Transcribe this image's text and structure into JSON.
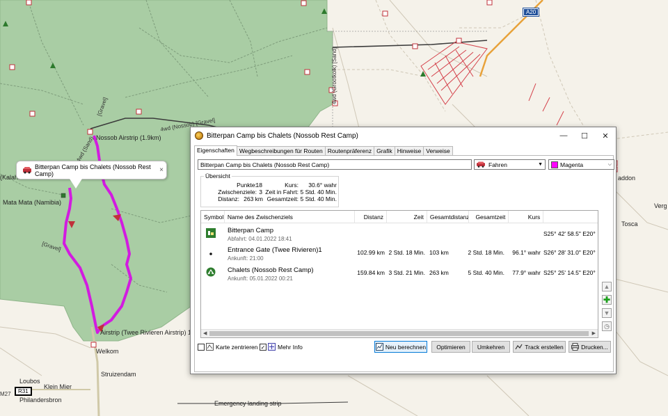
{
  "map": {
    "labels": {
      "nossob_airstrip": "Nossob Airstrip (1.9km)",
      "kalahari": "(Kalahari",
      "mata_mata": "Mata Mata (Namibia)",
      "gravel1": "[Gravel]",
      "gravel2": "[Gravel]",
      "nossob_road": "4wd (Nossob) [Gravel]",
      "grootkolk_road": "4wd (Grootkolk) [Sand]",
      "fourwd_sand": "4wd (Sand)",
      "twee_rivieren": "Airstrip (Twee Rivieren Airstrip) 1",
      "welkom": "Welkom",
      "struizendam": "Struizendam",
      "loubos": "Loubos",
      "klein_mier": "Klein Mier",
      "philandersbron": "Philandersbron",
      "emergency": "Emergency landing strip",
      "vergeleg": "Verg",
      "padda": "addon",
      "tosca": "Tosca",
      "a20": "A20",
      "r31": "R31",
      "m27": "M27"
    },
    "callout": {
      "text": "Bitterpan Camp bis Chalets (Nossob Rest Camp)",
      "close": "×"
    },
    "colors": {
      "route": "#d21be0",
      "park": "#a9cda4",
      "background": "#f5f2ea"
    }
  },
  "window": {
    "title": "Bitterpan Camp bis Chalets (Nossob Rest Camp)",
    "controls": {
      "minimize": "—",
      "maximize": "☐",
      "close": "✕"
    },
    "tabs": [
      "Eigenschaften",
      "Wegbeschreibungen für Routen",
      "Routenpräferenz",
      "Grafik",
      "Hinweise",
      "Verweise"
    ],
    "route_name": "Bitterpan Camp bis Chalets (Nossob Rest Camp)",
    "mode": "Fahren",
    "color": {
      "label": "Magenta",
      "hex": "#ff00ff"
    },
    "overview": {
      "legend": "Übersicht",
      "points_label": "Punkte:",
      "points": "18",
      "via_label": "Zwischenziele:",
      "via": "3",
      "distance_label": "Distanz:",
      "distance": "263 km",
      "course_label": "Kurs:",
      "course": "30.6° wahr",
      "drive_label": "Zeit in Fahrt:",
      "drive": "5 Std. 40 Min.",
      "total_label": "Gesamtzeit:",
      "total": "5 Std. 40 Min."
    },
    "table": {
      "columns": [
        "Symbol",
        "Name des Zwischenziels",
        "Distanz",
        "Zeit",
        "Gesamtdistanz",
        "Gesamtzeit",
        "Kurs",
        ""
      ],
      "rows": [
        {
          "icon": "camp-icon",
          "name": "Bitterpan Camp",
          "sub": "Abfahrt: 04.01.2022 18:41",
          "distance": "",
          "time": "",
          "total_distance": "",
          "total_time": "",
          "course": "",
          "position": "S25° 42' 58.5\" E20°"
        },
        {
          "icon": "dot-icon",
          "name": "Entrance Gate (Twee Rivieren)1",
          "sub": "Ankunft: 21:00",
          "distance": "102.99 km",
          "time": "2 Std. 18 Min.",
          "total_distance": "103 km",
          "total_time": "2 Std. 18 Min.",
          "course": "96.1° wahr",
          "position": "S26° 28' 31.0\" E20°"
        },
        {
          "icon": "chalet-icon",
          "name": "Chalets (Nossob Rest Camp)",
          "sub": "Ankunft: 05.01.2022 00:21",
          "distance": "159.84 km",
          "time": "3 Std. 21 Min.",
          "total_distance": "263 km",
          "total_time": "5 Std. 40 Min.",
          "course": "77.9° wahr",
          "position": "S25° 25' 14.5\" E20°"
        }
      ]
    },
    "bottom": {
      "center_map": "Karte zentrieren",
      "more_info": "Mehr Info",
      "recalc": "Neu berechnen",
      "optimize": "Optimieren",
      "reverse": "Umkehren",
      "track": "Track erstellen",
      "print": "Drucken..."
    }
  }
}
